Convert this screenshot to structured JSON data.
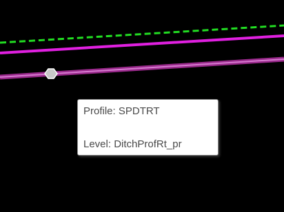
{
  "viewport": {
    "background": "#000000",
    "elements": [
      {
        "name": "design-line",
        "style": "dashed",
        "color": "#22dd22"
      },
      {
        "name": "profile-line",
        "style": "solid",
        "color": "#e020e0"
      },
      {
        "name": "selected-profile-line",
        "style": "solid-highlighted",
        "color": "#9a2a8c"
      }
    ],
    "snap_marker_icon": "hexagon-snap-marker-icon"
  },
  "tooltip": {
    "profile_text": "Profile: SPDTRT",
    "level_text": "Level: DitchProfRt_pr"
  }
}
